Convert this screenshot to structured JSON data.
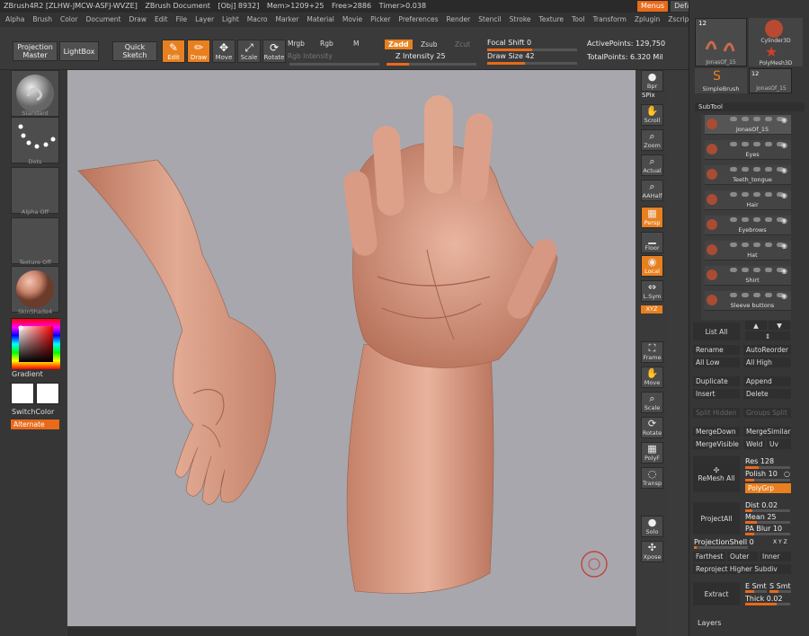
{
  "titlebar": {
    "app": "ZBrush4R2 [ZLHW-JMCW-ASFJ-WVZE]",
    "doc": "ZBrush Document",
    "obj": "[Obj] 8932]",
    "mem": "Mem>1209+25",
    "free": "Free>2886",
    "timer": "Timer>0.038",
    "menus_btn": "Menus",
    "script_btn": "DefaultZScript"
  },
  "menubar": [
    "Alpha",
    "Brush",
    "Color",
    "Document",
    "Draw",
    "Edit",
    "File",
    "Layer",
    "Light",
    "Macro",
    "Marker",
    "Material",
    "Movie",
    "Picker",
    "Preferences",
    "Render",
    "Stencil",
    "Stroke",
    "Texture",
    "Tool",
    "Transform",
    "Zplugin",
    "Zscript"
  ],
  "shelf": {
    "projection_master": "Projection Master",
    "lightbox": "LightBox",
    "quick_sketch": "Quick Sketch",
    "edit": "Edit",
    "draw": "Draw",
    "move": "Move",
    "scale": "Scale",
    "rotate": "Rotate",
    "mrgb": "Mrgb",
    "rgb": "Rgb",
    "m": "M",
    "rgb_intensity": "Rgb Intensity",
    "zadd": "Zadd",
    "zsub": "Zsub",
    "zcut": "Zcut",
    "z_intensity": "Z Intensity 25",
    "z_intensity_value": 25,
    "focal_shift": "Focal Shift 0",
    "draw_size": "Draw Size 42",
    "draw_size_value": 42,
    "active_points": "ActivePoints: 129,750",
    "total_points": "TotalPoints: 6.320 Mil"
  },
  "left": {
    "brush": "Standard",
    "stroke": "Dots",
    "alpha": "Alpha Off",
    "texture": "Texture Off",
    "material": "SkinShade4",
    "gradient": "Gradient",
    "switch_color": "SwitchColor",
    "alternate": "Alternate"
  },
  "rightstrip": [
    {
      "name": "Bpr",
      "glyph": "●"
    },
    {
      "name": "Scroll",
      "glyph": "✋"
    },
    {
      "name": "Zoom",
      "glyph": "⌕"
    },
    {
      "name": "Actual",
      "glyph": "⌕"
    },
    {
      "name": "AAHalf",
      "glyph": "⌕"
    },
    {
      "name": "Persp",
      "glyph": "▦"
    },
    {
      "name": "Floor",
      "glyph": "▁"
    },
    {
      "name": "Local",
      "glyph": "◉"
    },
    {
      "name": "L.Sym",
      "glyph": "⇔"
    },
    {
      "name": "Frame",
      "glyph": "⛶"
    },
    {
      "name": "Move",
      "glyph": "✋"
    },
    {
      "name": "Scale",
      "glyph": "⌕"
    },
    {
      "name": "Rotate",
      "glyph": "⟳"
    },
    {
      "name": "PolyF",
      "glyph": "▦"
    },
    {
      "name": "Transp",
      "glyph": "◌"
    },
    {
      "name": "Solo",
      "glyph": "●"
    },
    {
      "name": "Xpose",
      "glyph": "✣"
    }
  ],
  "rightstrip_extra": {
    "spix": "SPix",
    "xyz": "XYZ"
  },
  "tools": {
    "count": "12",
    "items": [
      "Cylinder3D",
      "PolyMesh3D",
      "SimpleBrush",
      "JonasOf_15"
    ],
    "main": "JonasOf_15"
  },
  "subtool": {
    "title": "SubTool",
    "rows": [
      "JonasOf_15",
      "Eyes",
      "Teeth_tongue",
      "Hair",
      "Eyebrows",
      "Hat",
      "Shirt",
      "Sleeve buttons"
    ]
  },
  "panel": {
    "list_all": "List All",
    "rename": "Rename",
    "auto_reorder": "AutoReorder",
    "all_low": "All Low",
    "all_high": "All High",
    "duplicate": "Duplicate",
    "append": "Append",
    "insert": "Insert",
    "delete": "Delete",
    "split_hidden": "Split Hidden",
    "groups_split": "Groups Split",
    "merge_down": "MergeDown",
    "merge_similar": "MergeSimilar",
    "merge_visible": "MergeVisible",
    "weld": "Weld",
    "uv": "Uv",
    "remesh_all": "ReMesh All",
    "res": "Res 128",
    "polish": "Polish 10",
    "polygrp": "PolyGrp",
    "project_all": "ProjectAll",
    "dist": "Dist 0.02",
    "mean": "Mean 25",
    "pa_blur": "PA Blur 10",
    "projection_shell": "ProjectionShell 0",
    "xyz_small": "X Y Z",
    "farthest": "Farthest",
    "outer": "Outer",
    "inner": "Inner",
    "reproject": "Reproject Higher Subdiv",
    "extract": "Extract",
    "e_smt": "E Smt",
    "s_smt": "S Smt",
    "thick": "Thick 0.02",
    "layers": "Layers"
  },
  "colors": {
    "accent": "#e8801f",
    "canvas_bg": "#a7a7ad",
    "skin": "#d9a189"
  }
}
